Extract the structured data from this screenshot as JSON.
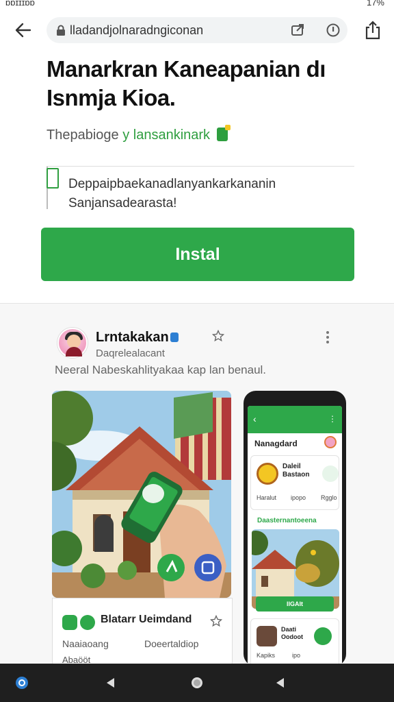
{
  "status_bar": {
    "left_text": "ɒɒɪɪɪɒɒ",
    "right_text": "17%"
  },
  "browser": {
    "url": "lladandjolnaradngiconan"
  },
  "hero": {
    "title": "Manarkran Kaneapanian dı Isnmja Kioa.",
    "subtitle_gray": "Thepabioge",
    "subtitle_green": "y lansankinark"
  },
  "notice": {
    "line1": "Deppaipbaekanadlanyankarkananin",
    "line2": "Sanjansadearasta!"
  },
  "install_label": "Instal",
  "post": {
    "author": "Lrntakakan",
    "handle": "Daqrelealacant",
    "caption": "Neeral Nabeskahlityakaa kap lan benaul."
  },
  "app_card": {
    "title": "Blatarr Ueimdand",
    "meta_left": "Naaiaoang",
    "meta_right": "Doeertaldiop",
    "meta_bottom": "Abaööt"
  },
  "phone_screen": {
    "header_title": "Nanagdard",
    "card1_name_1": "Daleil",
    "card1_name_2": "Bastaon",
    "card1_meta_a": "Haralut",
    "card1_meta_b": "ipopo",
    "card1_meta_c": "Rgglo",
    "section_label": "Daasternantoeena",
    "image_install": "IIGAIt",
    "card3_name_1": "Daati",
    "card3_name_2": "Oodoot",
    "card3_meta_a": "Kapiks",
    "card3_meta_b": "ipo"
  },
  "colors": {
    "accent_green": "#2ea84a",
    "nav_bar": "#1f1f1f"
  },
  "icons": {
    "back": "arrow-left-icon",
    "lock": "lock-icon",
    "tab": "external-tab-icon",
    "info": "info-icon",
    "share": "share-icon",
    "star": "star-icon",
    "more": "more-vertical-icon"
  }
}
